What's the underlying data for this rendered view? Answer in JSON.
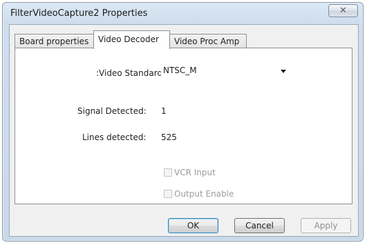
{
  "window": {
    "title": "FilterVideoCapture2 Properties",
    "close_glyph": "✕"
  },
  "tabs": [
    {
      "label": "Board properties",
      "active": false
    },
    {
      "label": "Video Decoder",
      "active": true
    },
    {
      "label": "Video Proc Amp",
      "active": false
    }
  ],
  "decoder": {
    "video_standard_label": ":Video Standard",
    "video_standard_value": "NTSC_M",
    "signal_detected_label": "Signal Detected:",
    "signal_detected_value": "1",
    "lines_detected_label": "Lines detected:",
    "lines_detected_value": "525",
    "vcr_input_label": "VCR Input",
    "vcr_input_checked": false,
    "vcr_input_enabled": false,
    "output_enable_label": "Output Enable",
    "output_enable_checked": false,
    "output_enable_enabled": false
  },
  "buttons": {
    "ok": "OK",
    "cancel": "Cancel",
    "apply": "Apply",
    "apply_enabled": false
  },
  "icons": {
    "close": "close-icon",
    "dropdown": "chevron-down-icon"
  }
}
